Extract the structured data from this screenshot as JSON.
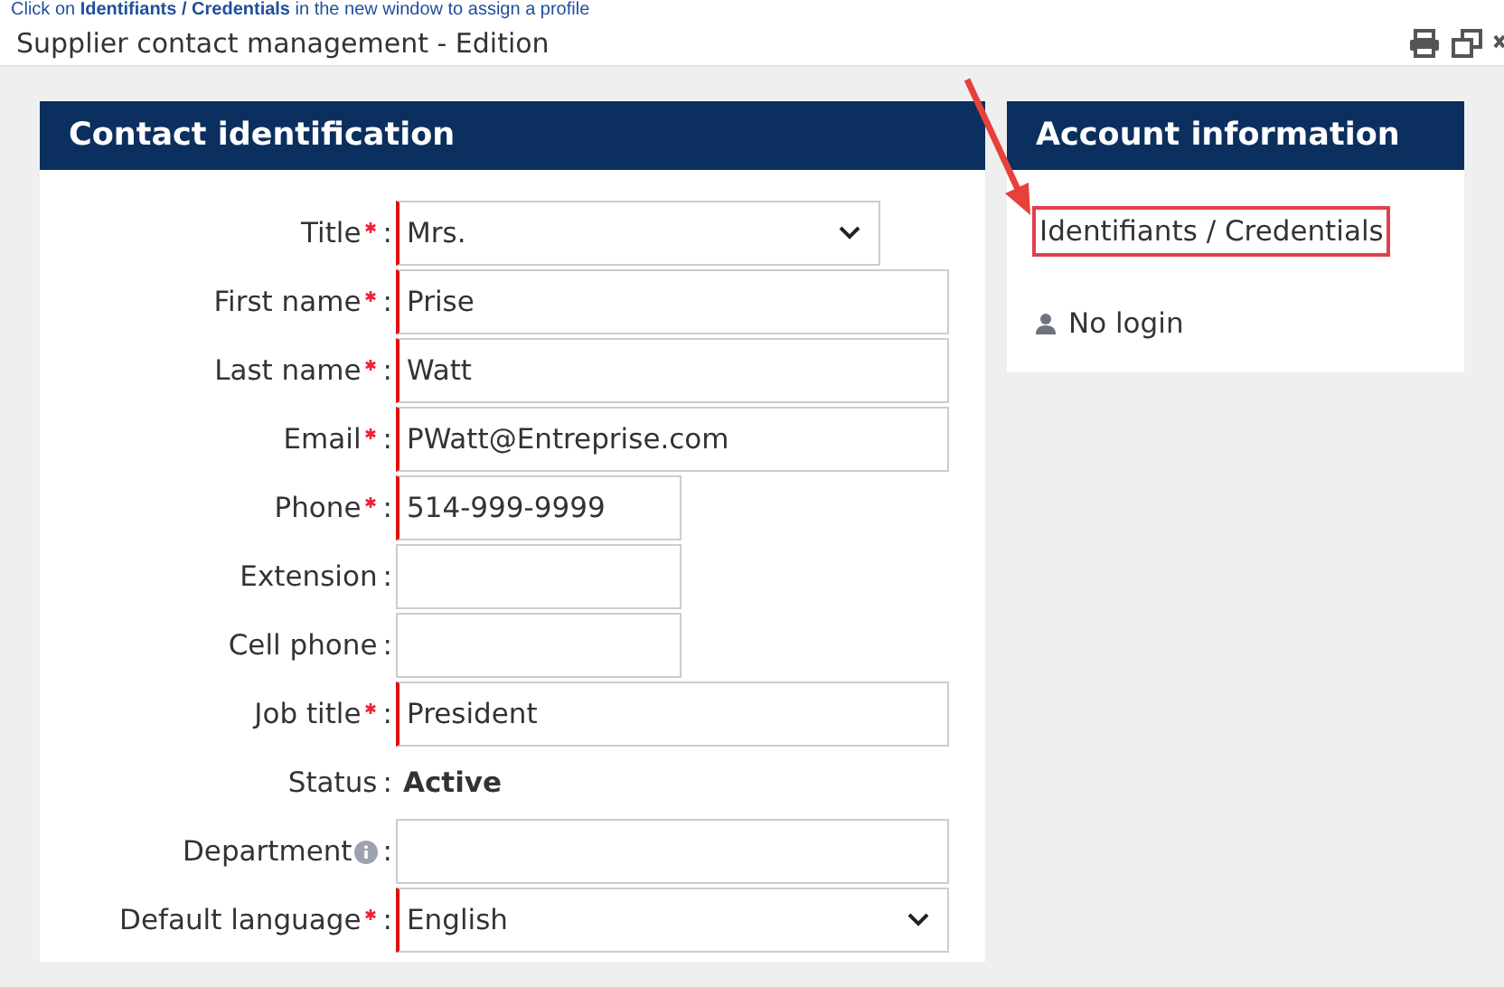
{
  "instruction": "Click on **Identifiants / Credentials** in the new window to assign a profile",
  "window": {
    "title": "Supplier contact management - Edition"
  },
  "contact_panel": {
    "title": "Contact identification",
    "fields": [
      {
        "kind": "select",
        "label": "Title",
        "required": true,
        "separator": ":",
        "value": "Mrs."
      },
      {
        "kind": "wide-text",
        "label": "First name",
        "required": true,
        "separator": ":",
        "value": "Prise"
      },
      {
        "kind": "wide-text",
        "label": "Last name",
        "required": true,
        "separator": ":",
        "value": "Watt"
      },
      {
        "kind": "wide-text",
        "label": "Email",
        "required": true,
        "separator": ":",
        "value": "PWatt@Entreprise.com"
      },
      {
        "kind": "short-text",
        "label": "Phone",
        "required": true,
        "separator": ":",
        "value": "514-999-9999"
      },
      {
        "kind": "short-text",
        "label": "Extension",
        "required": false,
        "separator": ":"
      },
      {
        "kind": "short-text",
        "label": "Cell phone",
        "required": false,
        "separator": ":"
      },
      {
        "kind": "wide-text",
        "label": "Job title",
        "required": true,
        "separator": ":",
        "value": "President"
      },
      {
        "kind": "static",
        "label": "Status",
        "required": false,
        "separator": ":",
        "value": "Active"
      },
      {
        "kind": "wide-text",
        "label": "Department",
        "required": false,
        "info": true,
        "separator": ":"
      },
      {
        "kind": "wide-select",
        "label": "Default language",
        "required": true,
        "separator": ":",
        "value": "English"
      }
    ]
  },
  "account_panel": {
    "title": "Account information",
    "link": "Identifiants / Credentials",
    "login_status": "No login"
  }
}
